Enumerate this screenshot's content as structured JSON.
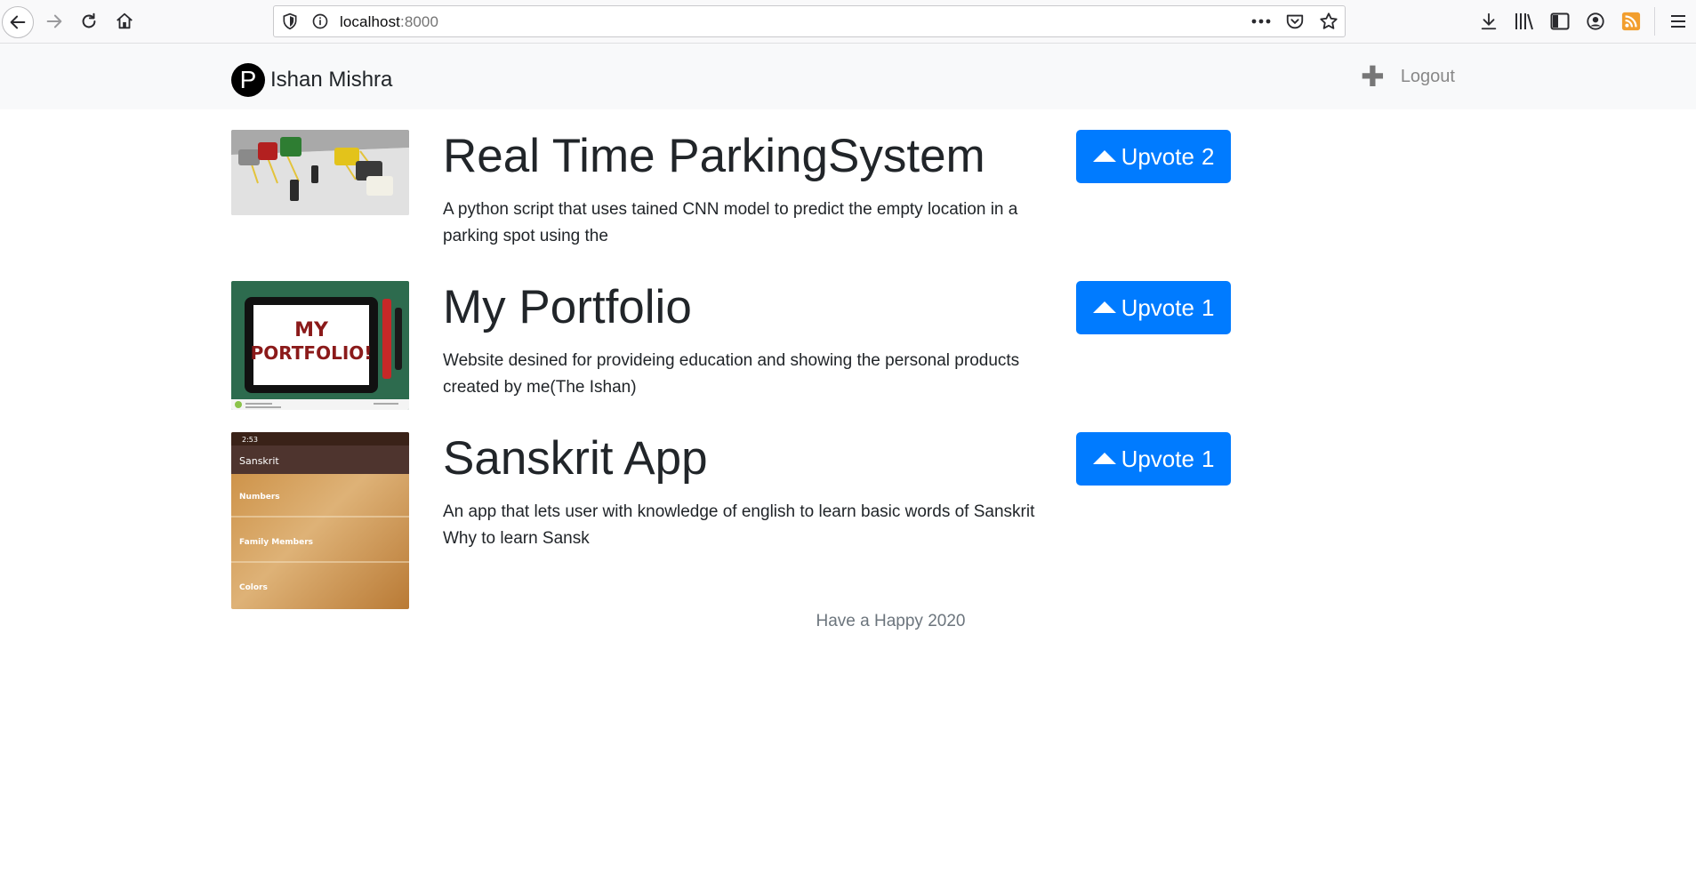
{
  "browser": {
    "url_host": "localhost",
    "url_port": ":8000"
  },
  "navbar": {
    "logo_letter": "P",
    "brand_name": "Ishan Mishra",
    "logout_label": "Logout"
  },
  "products": [
    {
      "title": "Real Time ParkingSystem",
      "description": "A python script that uses tained CNN model to predict the empty location in a parking spot using the",
      "upvote_label": "Upvote",
      "votes": "2"
    },
    {
      "title": "My Portfolio",
      "description": "Website desined for provideing education and showing the personal products created by me(The Ishan)",
      "upvote_label": "Upvote",
      "votes": "1",
      "image_text": [
        "MY",
        "PORTFOLIO!"
      ]
    },
    {
      "title": "Sanskrit App",
      "description": "An app that lets user with knowledge of english to learn basic words of Sanskrit Why to learn Sansk",
      "upvote_label": "Upvote",
      "votes": "1",
      "image_text": {
        "time": "2:53",
        "app_title": "Sanskrit",
        "items": [
          "Numbers",
          "Family Members",
          "Colors"
        ]
      }
    }
  ],
  "footer": {
    "text": "Have a Happy 2020"
  },
  "colors": {
    "accent": "#007bff",
    "navbar_bg": "#f8f9fa"
  }
}
